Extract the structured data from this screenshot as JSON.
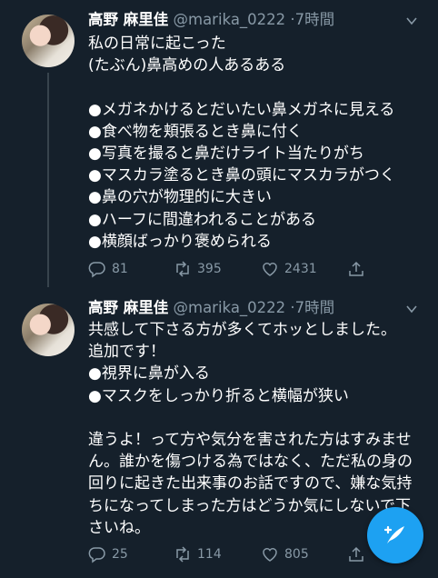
{
  "tweets": [
    {
      "name": "高野 麻里佳",
      "handle": "@marika_0222",
      "time": "·7時間",
      "text": "私の日常に起こった\n(たぶん)鼻高めの人あるある\n\n●メガネかけるとだいたい鼻メガネに見える\n●食べ物を頬張るとき鼻に付く\n●写真を撮ると鼻だけライト当たりがち\n●マスカラ塗るとき鼻の頭にマスカラがつく\n●鼻の穴が物理的に大きい\n●ハーフに間違われることがある\n●横顔ばっかり褒められる",
      "replies": "81",
      "retweets": "395",
      "likes": "2431"
    },
    {
      "name": "高野 麻里佳",
      "handle": "@marika_0222",
      "time": "·7時間",
      "text": "共感して下さる方が多くてホッとしました。\n追加です！\n●視界に鼻が入る\n●マスクをしっかり折ると横幅が狭い\n\n違うよ！って方や気分を害された方はすみません。誰かを傷つける為ではなく、ただ私の身の回りに起きた出来事のお話ですので、嫌な気持ちになってしまった方はどうか気にしないで下さいね。",
      "replies": "25",
      "retweets": "114",
      "likes": "805"
    }
  ],
  "icons": {
    "reply": "reply-icon",
    "retweet": "retweet-icon",
    "like": "like-icon",
    "share": "share-icon",
    "compose": "compose-tweet-icon"
  },
  "colors": {
    "background": "#15202b",
    "secondary_text": "#8899a6",
    "accent": "#1da1f2"
  }
}
